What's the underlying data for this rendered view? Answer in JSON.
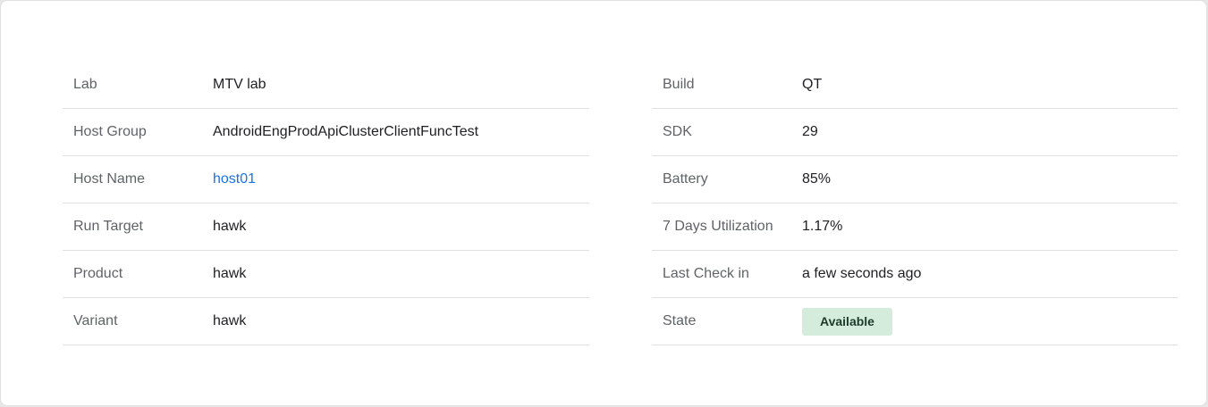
{
  "left": {
    "lab": {
      "label": "Lab",
      "value": "MTV lab"
    },
    "host_group": {
      "label": "Host Group",
      "value": "AndroidEngProdApiClusterClientFuncTest"
    },
    "host_name": {
      "label": "Host Name",
      "value": "host01"
    },
    "run_target": {
      "label": "Run Target",
      "value": "hawk"
    },
    "product": {
      "label": "Product",
      "value": "hawk"
    },
    "variant": {
      "label": "Variant",
      "value": "hawk"
    }
  },
  "right": {
    "build": {
      "label": "Build",
      "value": "QT"
    },
    "sdk": {
      "label": "SDK",
      "value": "29"
    },
    "battery": {
      "label": "Battery",
      "value": "85%"
    },
    "utilization": {
      "label": "7 Days Utilization",
      "value": "1.17%"
    },
    "last_check_in": {
      "label": "Last Check in",
      "value": "a few seconds ago"
    },
    "state": {
      "label": "State",
      "value": "Available"
    }
  },
  "colors": {
    "link": "#1a73e8",
    "state_badge_bg": "#d4ecdc",
    "label_text": "#5f6368",
    "divider": "#e0e0e0"
  }
}
